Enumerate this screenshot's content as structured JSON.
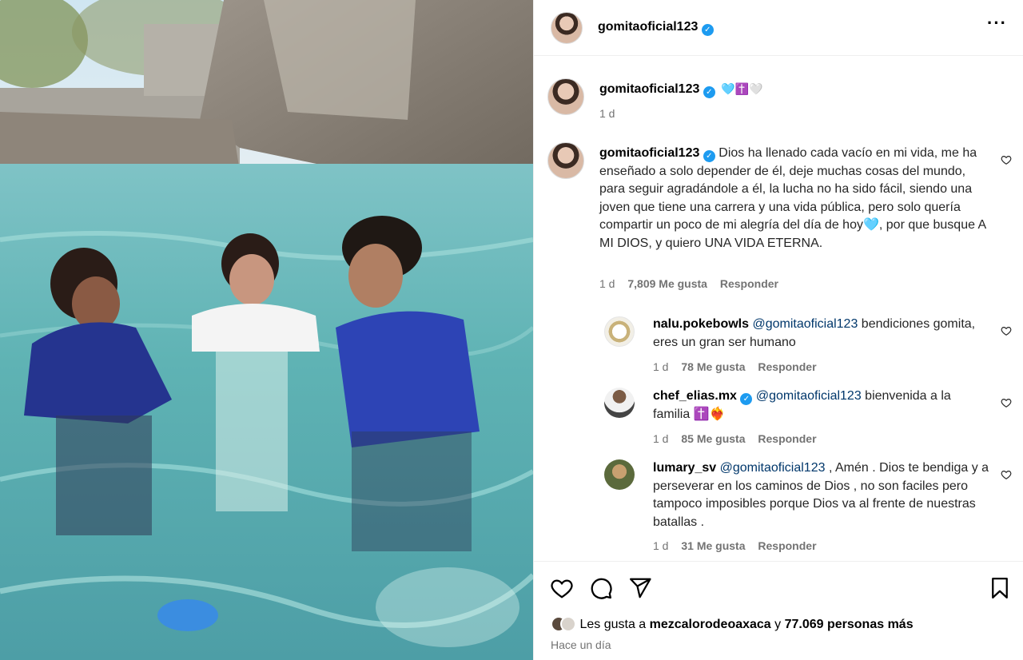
{
  "post": {
    "username": "gomitaoficial123",
    "more_icon": "more-horizontal-icon"
  },
  "caption_title": {
    "username": "gomitaoficial123",
    "emojis": "🩵✝️🤍",
    "time": "1 d"
  },
  "main_comment": {
    "username": "gomitaoficial123",
    "text": "Dios ha llenado cada vacío en mi vida, me ha enseñado a solo depender de él, deje muchas cosas del mundo, para seguir agradándole a él, la lucha no ha sido fácil, siendo una joven que tiene una carrera y una vida pública, pero solo quería compartir un poco de mi alegría del día de hoy🩵, por que busque A MI DIOS, y quiero UNA VIDA ETERNA.",
    "time": "1 d",
    "likes": "7,809 Me gusta",
    "reply": "Responder"
  },
  "replies": [
    {
      "username": "nalu.pokebowls",
      "mention": "@gomitaoficial123",
      "text": " bendiciones gomita, eres un gran ser humano",
      "time": "1 d",
      "likes": "78 Me gusta",
      "reply": "Responder"
    },
    {
      "username": "chef_elias.mx",
      "mention": "@gomitaoficial123",
      "text": " bienvenida a la familia ✝️❤️‍🔥",
      "time": "1 d",
      "likes": "85 Me gusta",
      "reply": "Responder"
    },
    {
      "username": "lumary_sv",
      "mention": "@gomitaoficial123",
      "text": " , Amén . Dios te bendiga y a perseverar en los caminos de Dios , no son faciles pero tampoco imposibles porque Dios va al frente de nuestras batallas .",
      "time": "1 d",
      "likes": "31 Me gusta",
      "reply": "Responder"
    }
  ],
  "footer": {
    "likes_prefix": "Les gusta a ",
    "likes_user": "mezcalorodeoaxaca",
    "likes_middle": " y ",
    "likes_count": "77.069 personas más",
    "timestamp": "Hace un día"
  },
  "colors": {
    "verified": "#1d9bf0",
    "mention": "#00376b",
    "muted": "#737373"
  }
}
